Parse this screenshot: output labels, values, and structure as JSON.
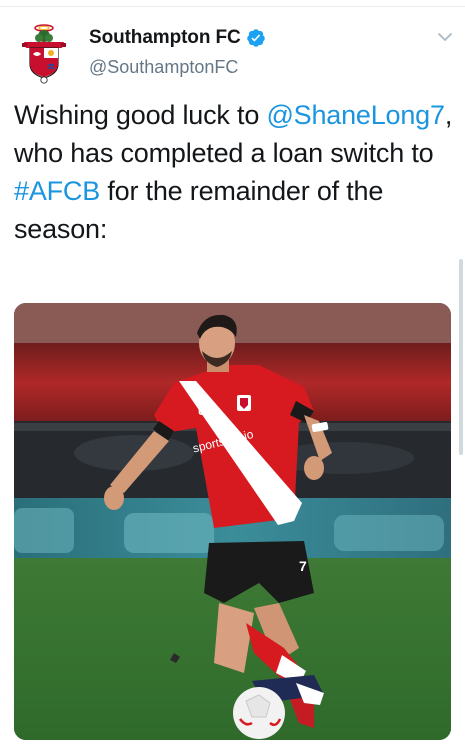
{
  "tweet": {
    "author_name": "Southampton FC",
    "handle": "@SouthamptonFC",
    "text_parts": [
      {
        "type": "text",
        "value": "Wishing good luck to "
      },
      {
        "type": "mention",
        "value": "@ShaneLong7"
      },
      {
        "type": "text",
        "value": ", who has completed a loan switch to "
      },
      {
        "type": "hashtag",
        "value": "#AFCB"
      },
      {
        "type": "text",
        "value": " for the remainder of the season:"
      }
    ],
    "sponsor_text": "sportsbet.io",
    "shirt_number": "7"
  },
  "icons": {
    "avatar": "club-crest-icon",
    "verified": "verified-badge-icon",
    "menu": "chevron-down-icon"
  },
  "colors": {
    "link": "#1b95e0",
    "verified": "#1da1f2",
    "text": "#14171a",
    "secondary": "#657786",
    "shirt_red": "#d71920"
  }
}
